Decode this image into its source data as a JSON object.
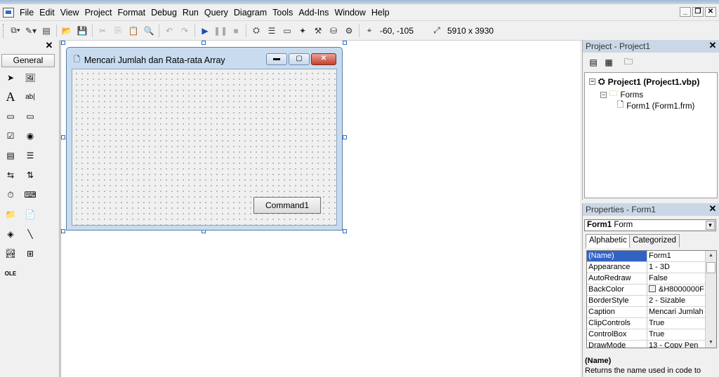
{
  "menu": [
    "File",
    "Edit",
    "View",
    "Project",
    "Format",
    "Debug",
    "Run",
    "Query",
    "Diagram",
    "Tools",
    "Add-Ins",
    "Window",
    "Help"
  ],
  "toolbar": {
    "position": "-60, -105",
    "size": "5910 x 3930"
  },
  "toolbox": {
    "tab": "General",
    "close": "✕"
  },
  "form": {
    "title": "Mencari Jumlah dan Rata-rata Array",
    "button_caption": "Command1"
  },
  "project": {
    "panel_title": "Project - Project1",
    "root": "Project1 (Project1.vbp)",
    "folder": "Forms",
    "item": "Form1 (Form1.frm)"
  },
  "properties": {
    "panel_title": "Properties - Form1",
    "object_name": "Form1",
    "object_type": "Form",
    "tabs": [
      "Alphabetic",
      "Categorized"
    ],
    "rows": [
      {
        "name": "(Name)",
        "value": "Form1"
      },
      {
        "name": "Appearance",
        "value": "1 - 3D"
      },
      {
        "name": "AutoRedraw",
        "value": "False"
      },
      {
        "name": "BackColor",
        "value": "&H8000000F"
      },
      {
        "name": "BorderStyle",
        "value": "2 - Sizable"
      },
      {
        "name": "Caption",
        "value": "Mencari Jumlah"
      },
      {
        "name": "ClipControls",
        "value": "True"
      },
      {
        "name": "ControlBox",
        "value": "True"
      },
      {
        "name": "DrawMode",
        "value": "13 - Copy Pen"
      }
    ],
    "desc_title": "(Name)",
    "desc_text": "Returns the name used in code to"
  },
  "colors": {
    "selected_row": "#3163c5",
    "panel_title_bg": "#c9d7e6",
    "form_frame": "#c9dcef"
  }
}
